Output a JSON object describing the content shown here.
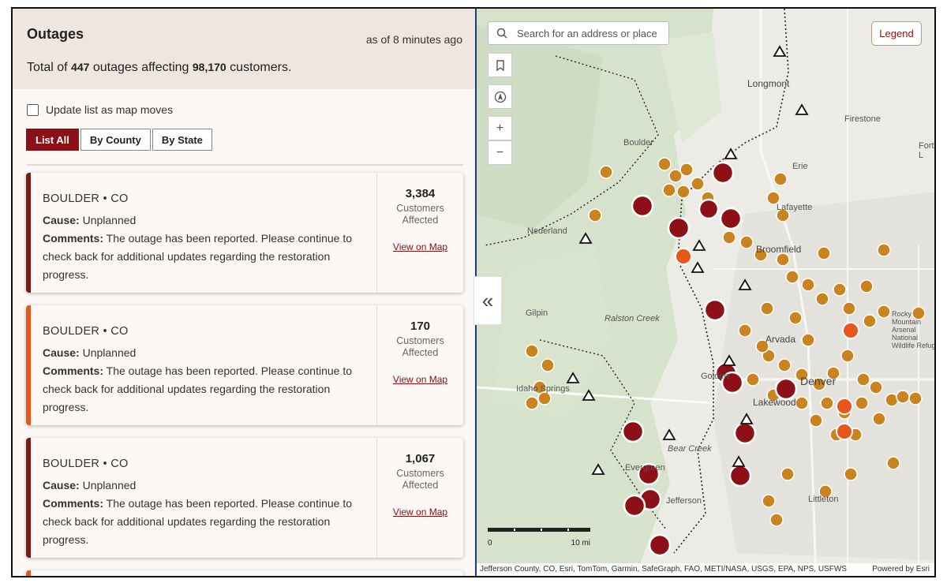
{
  "panel": {
    "title": "Outages",
    "updated": "as of 8 minutes ago",
    "total_prefix": "Total of",
    "total_outages": "447",
    "total_middle": "outages affecting",
    "total_customers": "98,170",
    "total_suffix": "customers.",
    "update_checkbox_label": "Update list as map moves",
    "tabs": [
      {
        "label": "List All"
      },
      {
        "label": "By County"
      },
      {
        "label": "By State"
      }
    ]
  },
  "outages": [
    {
      "location": "BOULDER • CO",
      "cause_label": "Cause:",
      "cause": "Unplanned",
      "comments_label": "Comments:",
      "comments": "The outage has been reported. Please continue to check back for additional updates regarding the restoration progress.",
      "customers": "3,384",
      "customers_label": "Customers Affected",
      "link": "View on Map",
      "color": "#7a1a12"
    },
    {
      "location": "BOULDER • CO",
      "cause_label": "Cause:",
      "cause": "Unplanned",
      "comments_label": "Comments:",
      "comments": "The outage has been reported. Please continue to check back for additional updates regarding the restoration progress.",
      "customers": "170",
      "customers_label": "Customers Affected",
      "link": "View on Map",
      "color": "#e8561c"
    },
    {
      "location": "BOULDER • CO",
      "cause_label": "Cause:",
      "cause": "Unplanned",
      "comments_label": "Comments:",
      "comments": "The outage has been reported. Please continue to check back for additional updates regarding the restoration progress.",
      "customers": "1,067",
      "customers_label": "Customers Affected",
      "link": "View on Map",
      "color": "#7a1a12"
    }
  ],
  "map": {
    "search_placeholder": "Search for an address or place",
    "legend_label": "Legend",
    "collapse_icon": "double-chevron-left-icon",
    "scale_start": "0",
    "scale_end": "10 mi",
    "attribution": "Jefferson County, CO, Esri, TomTom, Garmin, SafeGraph, FAO, METI/NASA, USGS, EPA, NPS, USFWS",
    "powered_by": "Powered by Esri",
    "place_labels": [
      "Longmont",
      "Firestone",
      "Fort L",
      "Erie",
      "Lafayette",
      "Boulder",
      "Nederland",
      "Broomfield",
      "Gilpin",
      "Ralston Creek",
      "Arvada",
      "Idaho Springs",
      "Golden",
      "Lakewood",
      "Denver",
      "Evergreen",
      "Bear Creek",
      "Jefferson",
      "Littleton",
      "Rocky Mountain Arsenal National Wildlife Refuge"
    ],
    "colors": {
      "major": "#8c1016",
      "medium": "#e8561c",
      "minor": "#c98420",
      "accent": "#8c1016"
    }
  }
}
